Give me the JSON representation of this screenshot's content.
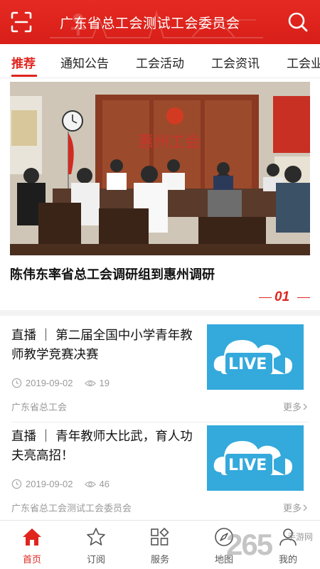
{
  "header": {
    "title": "广东省总工会测试工会委员会",
    "left_icon": "scan-icon",
    "right_icon": "search-icon",
    "bg_color": "#e0251e"
  },
  "tabs": [
    {
      "label": "推荐",
      "active": true
    },
    {
      "label": "通知公告",
      "active": false
    },
    {
      "label": "工会活动",
      "active": false
    },
    {
      "label": "工会资讯",
      "active": false
    },
    {
      "label": "工会业",
      "active": false
    }
  ],
  "hero": {
    "title": "陈伟东率省总工会调研组到惠州调研",
    "index": "01",
    "wall_sign": "惠州工会"
  },
  "news": [
    {
      "title": "直播 ｜ 第二届全国中小学青年教师教学竞赛决赛",
      "date": "2019-09-02",
      "views": "19",
      "source": "广东省总工会",
      "more": "更多",
      "thumb_label": "LIVE"
    },
    {
      "title": "直播 ｜ 青年教师大比武，育人功夫亮高招！",
      "date": "2019-09-02",
      "views": "46",
      "source": "广东省总工会测试工会委员会",
      "more": "更多",
      "thumb_label": "LIVE"
    }
  ],
  "bottom_nav": [
    {
      "label": "首页",
      "icon": "home-icon",
      "active": true
    },
    {
      "label": "订阅",
      "icon": "star-icon",
      "active": false
    },
    {
      "label": "服务",
      "icon": "grid-icon",
      "active": false
    },
    {
      "label": "地图",
      "icon": "compass-icon",
      "active": false
    },
    {
      "label": "我的",
      "icon": "user-icon",
      "active": false
    }
  ],
  "watermark": {
    "number": "265",
    "text": "手游网"
  },
  "colors": {
    "accent": "#e0251e",
    "live_blue": "#34a9dc",
    "meta_gray": "#9a9a9a"
  }
}
